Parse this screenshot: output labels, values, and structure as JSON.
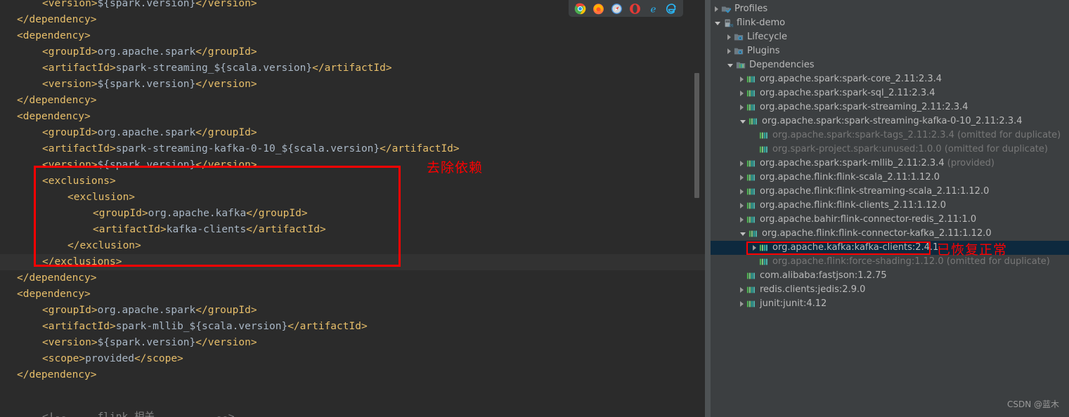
{
  "editor": {
    "name": "pom-xml-editor",
    "background_color": "#2b2b2b",
    "tag_color": "#e8bf6a",
    "text_color": "#a9b7c6",
    "current_line_color": "#323232",
    "lines": [
      {
        "indent": 2,
        "text": "<version>${spark.version}</version>",
        "clipped_top": true,
        "current": false
      },
      {
        "indent": 1,
        "text": "</dependency>",
        "current": false
      },
      {
        "indent": 1,
        "text": "<dependency>",
        "current": false
      },
      {
        "indent": 2,
        "text": "<groupId>org.apache.spark</groupId>",
        "current": false
      },
      {
        "indent": 2,
        "text": "<artifactId>spark-streaming_${scala.version}</artifactId>",
        "current": false
      },
      {
        "indent": 2,
        "text": "<version>${spark.version}</version>",
        "current": false
      },
      {
        "indent": 1,
        "text": "</dependency>",
        "current": false
      },
      {
        "indent": 1,
        "text": "<dependency>",
        "current": false
      },
      {
        "indent": 2,
        "text": "<groupId>org.apache.spark</groupId>",
        "current": false
      },
      {
        "indent": 2,
        "text": "<artifactId>spark-streaming-kafka-0-10_${scala.version}</artifactId>",
        "current": false
      },
      {
        "indent": 2,
        "text": "<version>${spark.version}</version>",
        "current": false
      },
      {
        "indent": 2,
        "text": "<exclusions>",
        "current": false
      },
      {
        "indent": 3,
        "text": "<exclusion>",
        "current": false
      },
      {
        "indent": 4,
        "text": "<groupId>org.apache.kafka</groupId>",
        "current": false
      },
      {
        "indent": 4,
        "text": "<artifactId>kafka-clients</artifactId>",
        "current": false
      },
      {
        "indent": 3,
        "text": "</exclusion>",
        "current": false
      },
      {
        "indent": 2,
        "text": "</exclusions>",
        "current": true
      },
      {
        "indent": 1,
        "text": "</dependency>",
        "current": false
      },
      {
        "indent": 1,
        "text": "<dependency>",
        "current": false
      },
      {
        "indent": 2,
        "text": "<groupId>org.apache.spark</groupId>",
        "current": false
      },
      {
        "indent": 2,
        "text": "<artifactId>spark-mllib_${scala.version}</artifactId>",
        "current": false
      },
      {
        "indent": 2,
        "text": "<version>${spark.version}</version>",
        "current": false
      },
      {
        "indent": 2,
        "text": "<scope>provided</scope>",
        "current": false
      },
      {
        "indent": 1,
        "text": "</dependency>",
        "current": false
      }
    ],
    "bottom_partial_line": "<!--     flink 相关          -->",
    "annotation": {
      "text": "去除依赖",
      "color": "#ff0000"
    }
  },
  "browser_bar": {
    "name": "browser-preview-bar",
    "icons": [
      {
        "name": "chrome-icon",
        "label": "Chrome"
      },
      {
        "name": "firefox-icon",
        "label": "Firefox"
      },
      {
        "name": "safari-icon",
        "label": "Safari"
      },
      {
        "name": "opera-icon",
        "label": "Opera"
      },
      {
        "name": "internet-explorer-icon",
        "label": "Internet Explorer"
      },
      {
        "name": "edge-icon",
        "label": "Microsoft Edge"
      }
    ]
  },
  "maven": {
    "name": "maven-tool-window",
    "background_color": "#3c3f41",
    "selected_color": "#0d293e",
    "annotation": {
      "text": "已恢复正常",
      "color": "#ff0000"
    },
    "tree": [
      {
        "depth": 0,
        "twisty": "collapsed",
        "icon": "profiles-icon",
        "label": "Profiles",
        "dim": false,
        "selected": false
      },
      {
        "depth": 0,
        "twisty": "expanded",
        "icon": "maven-module-icon",
        "label": "flink-demo",
        "dim": false,
        "selected": false
      },
      {
        "depth": 1,
        "twisty": "collapsed",
        "icon": "folder-gear-icon",
        "label": "Lifecycle",
        "dim": false,
        "selected": false
      },
      {
        "depth": 1,
        "twisty": "collapsed",
        "icon": "folder-gear-icon",
        "label": "Plugins",
        "dim": false,
        "selected": false
      },
      {
        "depth": 1,
        "twisty": "expanded",
        "icon": "folder-bars-icon",
        "label": "Dependencies",
        "dim": false,
        "selected": false
      },
      {
        "depth": 2,
        "twisty": "collapsed",
        "icon": "dependency-icon",
        "label": "org.apache.spark:spark-core_2.11:2.3.4",
        "dim": false,
        "selected": false
      },
      {
        "depth": 2,
        "twisty": "collapsed",
        "icon": "dependency-icon",
        "label": "org.apache.spark:spark-sql_2.11:2.3.4",
        "dim": false,
        "selected": false
      },
      {
        "depth": 2,
        "twisty": "collapsed",
        "icon": "dependency-icon",
        "label": "org.apache.spark:spark-streaming_2.11:2.3.4",
        "dim": false,
        "selected": false
      },
      {
        "depth": 2,
        "twisty": "expanded",
        "icon": "dependency-icon",
        "label": "org.apache.spark:spark-streaming-kafka-0-10_2.11:2.3.4",
        "dim": false,
        "selected": false
      },
      {
        "depth": 3,
        "twisty": "none",
        "icon": "dependency-icon",
        "label": "org.apache.spark:spark-tags_2.11:2.3.4 (omitted for duplicate)",
        "dim": true,
        "selected": false
      },
      {
        "depth": 3,
        "twisty": "none",
        "icon": "dependency-icon",
        "label": "org.spark-project.spark:unused:1.0.0 (omitted for duplicate)",
        "dim": true,
        "selected": false
      },
      {
        "depth": 2,
        "twisty": "collapsed",
        "icon": "dependency-icon",
        "label": "org.apache.spark:spark-mllib_2.11:2.3.4",
        "suffix": " (provided)",
        "dim": false,
        "selected": false
      },
      {
        "depth": 2,
        "twisty": "collapsed",
        "icon": "dependency-icon",
        "label": "org.apache.flink:flink-scala_2.11:1.12.0",
        "dim": false,
        "selected": false
      },
      {
        "depth": 2,
        "twisty": "collapsed",
        "icon": "dependency-icon",
        "label": "org.apache.flink:flink-streaming-scala_2.11:1.12.0",
        "dim": false,
        "selected": false
      },
      {
        "depth": 2,
        "twisty": "collapsed",
        "icon": "dependency-icon",
        "label": "org.apache.flink:flink-clients_2.11:1.12.0",
        "dim": false,
        "selected": false
      },
      {
        "depth": 2,
        "twisty": "collapsed",
        "icon": "dependency-icon",
        "label": "org.apache.bahir:flink-connector-redis_2.11:1.0",
        "dim": false,
        "selected": false
      },
      {
        "depth": 2,
        "twisty": "expanded",
        "icon": "dependency-icon",
        "label": "org.apache.flink:flink-connector-kafka_2.11:1.12.0",
        "dim": false,
        "selected": false
      },
      {
        "depth": 3,
        "twisty": "collapsed",
        "icon": "dependency-icon",
        "label": "org.apache.kafka:kafka-clients:2.4.1",
        "dim": false,
        "selected": true
      },
      {
        "depth": 3,
        "twisty": "none",
        "icon": "dependency-icon",
        "label": "org.apache.flink:force-shading:1.12.0 (omitted for duplicate)",
        "dim": true,
        "selected": false
      },
      {
        "depth": 2,
        "twisty": "none",
        "icon": "dependency-icon",
        "label": "com.alibaba:fastjson:1.2.75",
        "dim": false,
        "selected": false
      },
      {
        "depth": 2,
        "twisty": "collapsed",
        "icon": "dependency-icon",
        "label": "redis.clients:jedis:2.9.0",
        "dim": false,
        "selected": false
      },
      {
        "depth": 2,
        "twisty": "collapsed",
        "icon": "dependency-icon",
        "label": "junit:junit:4.12",
        "dim": false,
        "selected": false
      }
    ]
  },
  "watermark": {
    "name": "csdn-watermark",
    "text": "CSDN @蓝木"
  }
}
